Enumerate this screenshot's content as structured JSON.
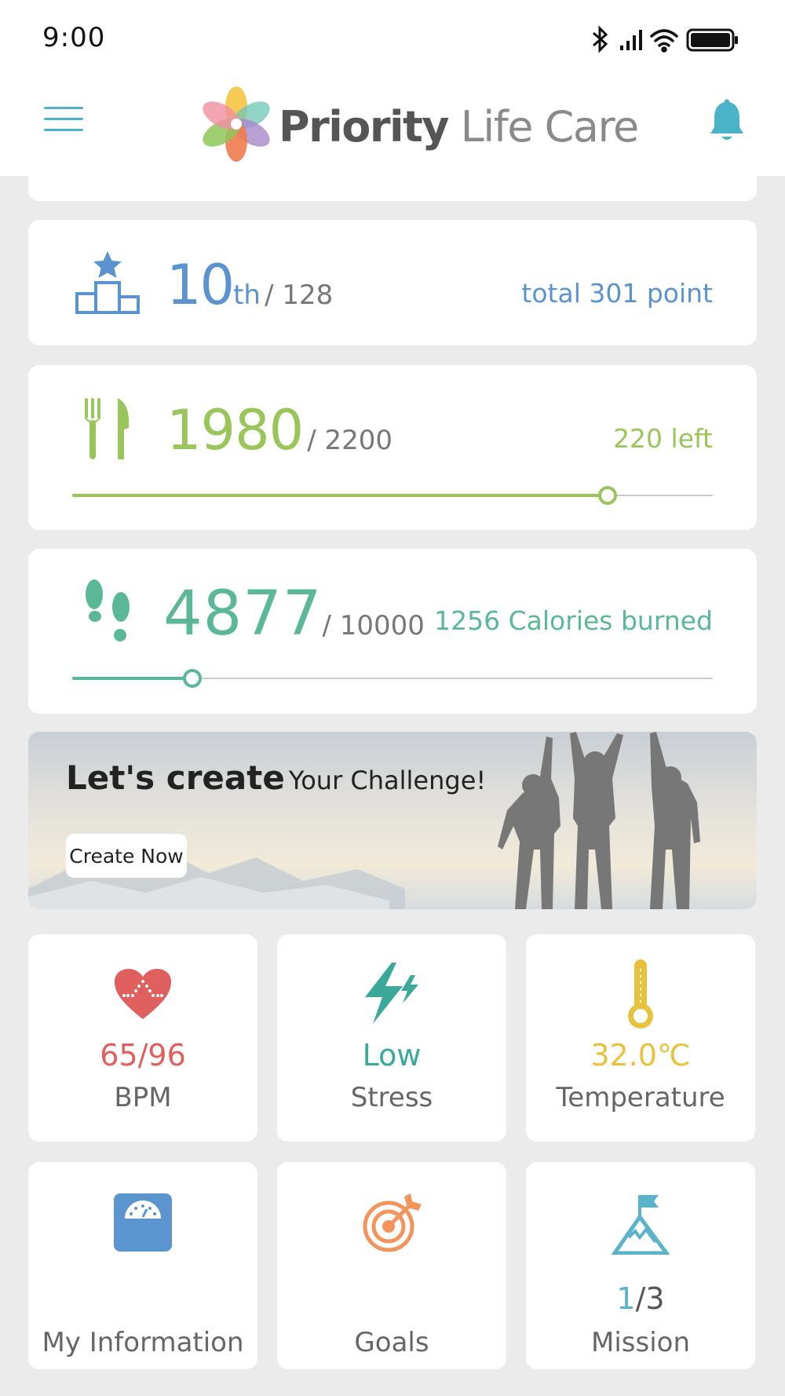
{
  "status_bar": {
    "time": "9:00"
  },
  "header": {
    "brand_bold": "Priority",
    "brand_light": "Life Care",
    "accent": "#4bb3c8"
  },
  "rank": {
    "value": "10",
    "suffix": "th",
    "total": "/ 128",
    "points": "total 301 point",
    "color": "#5a93cf"
  },
  "food": {
    "value": "1980",
    "total": "/ 2200",
    "remaining": "220 left",
    "progress": 0.836,
    "color": "#9ac55b"
  },
  "steps": {
    "value": "4877",
    "total": "/ 10000",
    "calories": "1256 Calories burned",
    "progress": 0.188,
    "color": "#5ab896"
  },
  "banner": {
    "title_bold": "Let's create",
    "title_light": "Your Challenge!",
    "button": "Create Now"
  },
  "tiles": {
    "bpm": {
      "value": "65/96",
      "label": "BPM",
      "color": "#e0605f"
    },
    "stress": {
      "value": "Low",
      "label": "Stress",
      "color": "#3aa99a"
    },
    "temperature": {
      "value": "32.0℃",
      "label": "Temperature",
      "color": "#e8c23c"
    },
    "my_info": {
      "label": "My Information",
      "color": "#5b95cf"
    },
    "goals": {
      "label": "Goals",
      "color": "#f2945b"
    },
    "mission": {
      "done": "1",
      "total": "/3",
      "label": "Mission",
      "color": "#5ab3c9"
    }
  }
}
